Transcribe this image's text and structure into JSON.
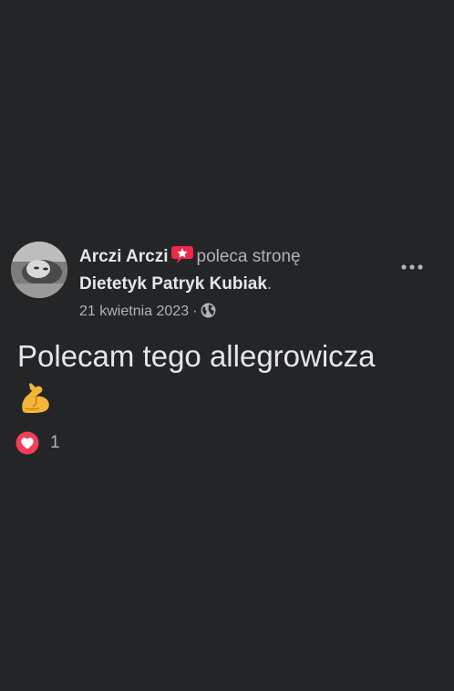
{
  "post": {
    "author": "Arczi Arczi",
    "action": "poleca stronę",
    "page_name": "Dietetyk Patryk Kubiak",
    "period": ".",
    "date": "21 kwietnia 2023",
    "separator": "·",
    "privacy_icon": "globe-icon",
    "body_text": "Polecam tego allegrowicza",
    "emoji": "flexed-biceps-emoji",
    "reaction_icon": "love-reaction-icon",
    "reaction_count": "1"
  },
  "colors": {
    "background": "#242526",
    "primary_text": "#e4e6eb",
    "secondary_text": "#b0b3b8",
    "badge": "#f02849",
    "love": "#f33e58"
  }
}
